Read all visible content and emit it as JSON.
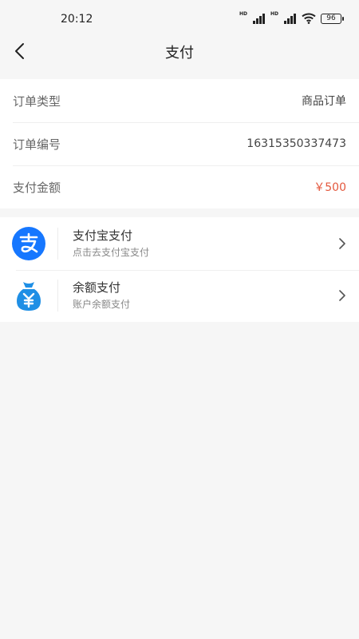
{
  "status_bar": {
    "time": "20:12",
    "battery": "96",
    "signal_label": "HD"
  },
  "nav": {
    "title": "支付"
  },
  "order": {
    "rows": [
      {
        "label": "订单类型",
        "value": "商品订单"
      },
      {
        "label": "订单编号",
        "value": "16315350337473"
      },
      {
        "label": "支付金额",
        "value": "￥500"
      }
    ]
  },
  "payment_methods": [
    {
      "title": "支付宝支付",
      "subtitle": "点击去支付宝支付",
      "icon": "alipay-icon"
    },
    {
      "title": "余额支付",
      "subtitle": "账户余额支付",
      "icon": "money-bag-icon"
    }
  ],
  "colors": {
    "amount": "#e4583e",
    "alipay_blue": "#1677ff",
    "balance_blue": "#1f8fe5"
  }
}
